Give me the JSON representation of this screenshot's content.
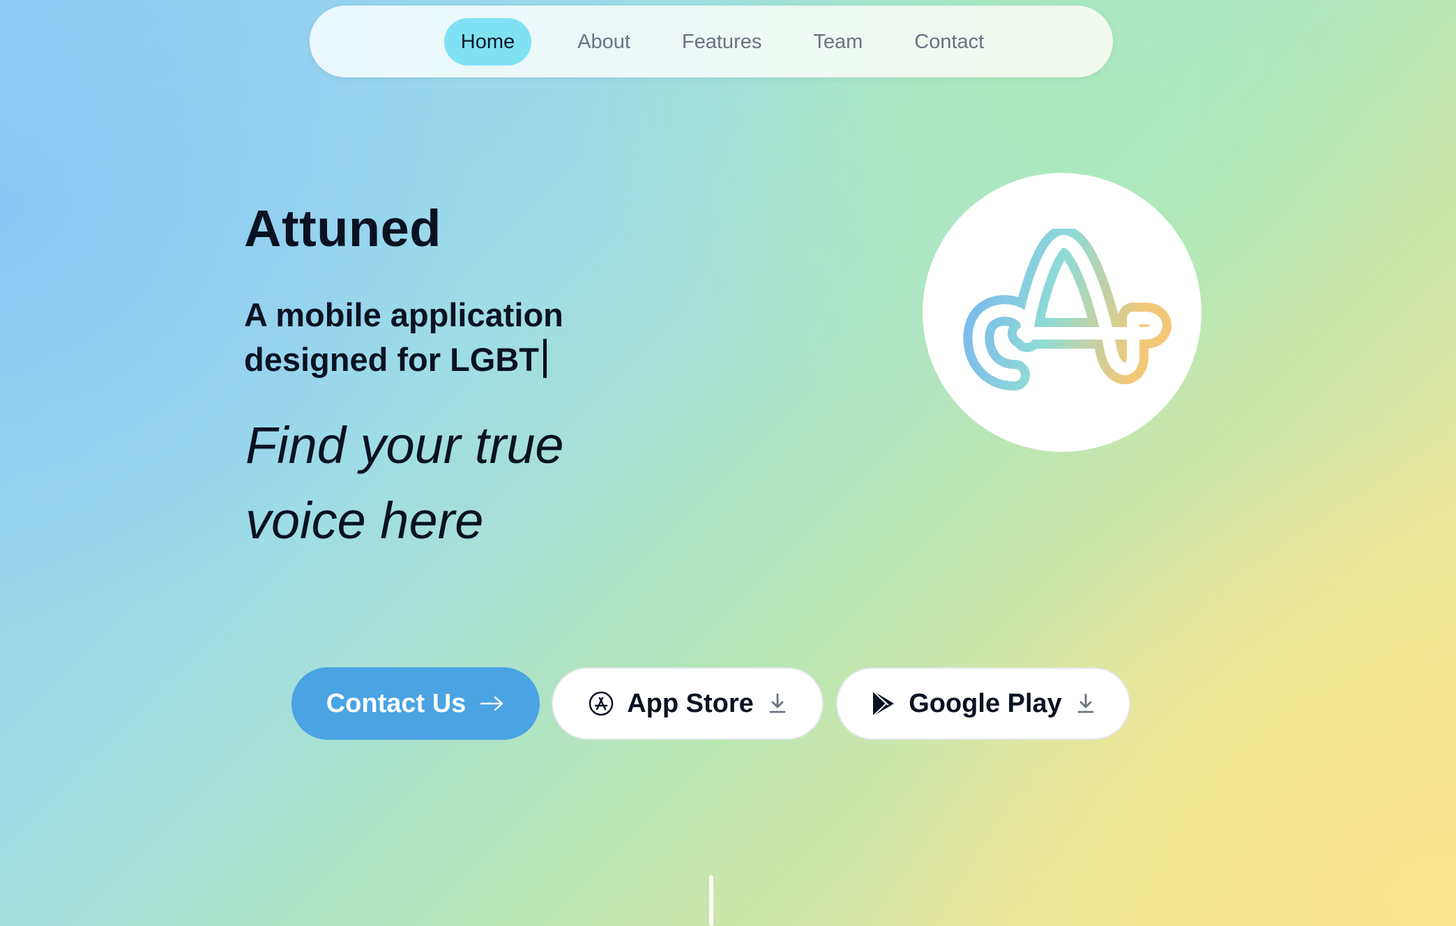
{
  "nav": {
    "items": [
      {
        "label": "Home",
        "active": true
      },
      {
        "label": "About",
        "active": false
      },
      {
        "label": "Features",
        "active": false
      },
      {
        "label": "Team",
        "active": false
      },
      {
        "label": "Contact",
        "active": false
      }
    ]
  },
  "hero": {
    "title": "Attuned",
    "subtitle": "A mobile application designed for LGBT",
    "tagline": "Find your true voice here"
  },
  "logo": {
    "icon": "attuned-logo-icon",
    "gradient_colors": [
      "#7ab8ef",
      "#8fdbd5",
      "#f2c878"
    ]
  },
  "buttons": {
    "contact_label": "Contact Us",
    "contact_icon": "arrow-right-icon",
    "appstore_label": "App Store",
    "appstore_icon": "app-store-icon",
    "googleplay_label": "Google Play",
    "googleplay_icon": "google-play-icon",
    "download_icon": "download-icon"
  },
  "colors": {
    "accent_active_nav": "#7fe2f2",
    "primary_button": "#4aa3e3",
    "text_dark": "#0a1222",
    "nav_text": "#6b7280"
  }
}
